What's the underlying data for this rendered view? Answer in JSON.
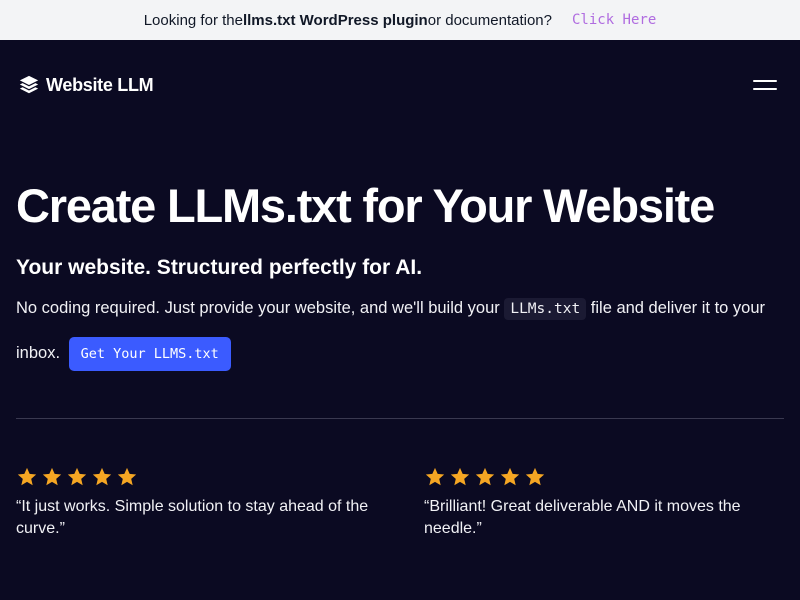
{
  "announcement": {
    "prefix": "Looking for the ",
    "highlight": "llms.txt WordPress plugin",
    "suffix": " or documentation?",
    "link_label": "Click Here"
  },
  "nav": {
    "logo_text": "Website LLM",
    "logo_icon": "layers-icon",
    "menu_icon": "hamburger-menu-icon"
  },
  "hero": {
    "title": "Create LLMs.txt for Your Website",
    "subtitle": "Your website. Structured perfectly for AI.",
    "desc_before": "No coding required. Just provide your website, and we'll build your ",
    "desc_code": "LLMs.txt",
    "desc_after": " file and deliver it to your inbox.",
    "cta_label": "Get Your LLMS.txt"
  },
  "testimonials": [
    {
      "rating": 5,
      "quote": "“It just works. Simple solution to stay ahead of the curve.”"
    },
    {
      "rating": 5,
      "quote": "“Brilliant! Great deliverable AND it moves the needle.”"
    }
  ],
  "colors": {
    "background": "#0b0a22",
    "accent": "#3b5bff",
    "link": "#b06ce0",
    "star": "#f5a623"
  }
}
